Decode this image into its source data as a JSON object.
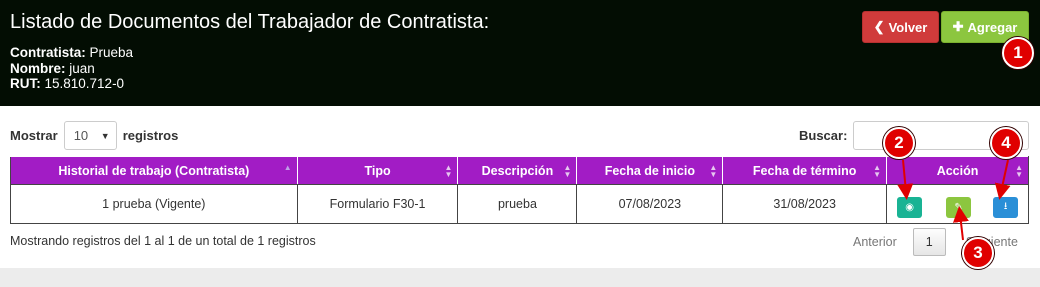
{
  "header": {
    "title": "Listado de Documentos del Trabajador de Contratista:",
    "contratista_label": "Contratista:",
    "contratista_value": " Prueba",
    "nombre_label": "Nombre:",
    "nombre_value": " juan",
    "rut_label": "RUT:",
    "rut_value": " 15.810.712-0",
    "volver_label": "Volver",
    "agregar_label": "Agregar"
  },
  "controls": {
    "mostrar_label": "Mostrar",
    "length_value": "10",
    "registros_label": "registros",
    "buscar_label": "Buscar:"
  },
  "table": {
    "columns": [
      "Historial de trabajo (Contratista)",
      "Tipo",
      "Descripción",
      "Fecha de inicio",
      "Fecha de término",
      "Acción"
    ],
    "rows": [
      [
        "1 prueba (Vigente)",
        "Formulario F30-1",
        "prueba",
        "07/08/2023",
        "31/08/2023"
      ]
    ]
  },
  "footer": {
    "summary": "Mostrando registros del 1 al 1 de un total de 1 registros",
    "prev": "Anterior",
    "page": "1",
    "next": "Siguiente"
  },
  "annotations": [
    "1",
    "2",
    "3",
    "4"
  ],
  "colors": {
    "header_bg": "#030d03",
    "table_header": "#a21cc5",
    "volver": "#d03b3b",
    "agregar": "#8cc63f",
    "view": "#19b394",
    "download": "#2a8fd7",
    "marker": "#e00000"
  }
}
